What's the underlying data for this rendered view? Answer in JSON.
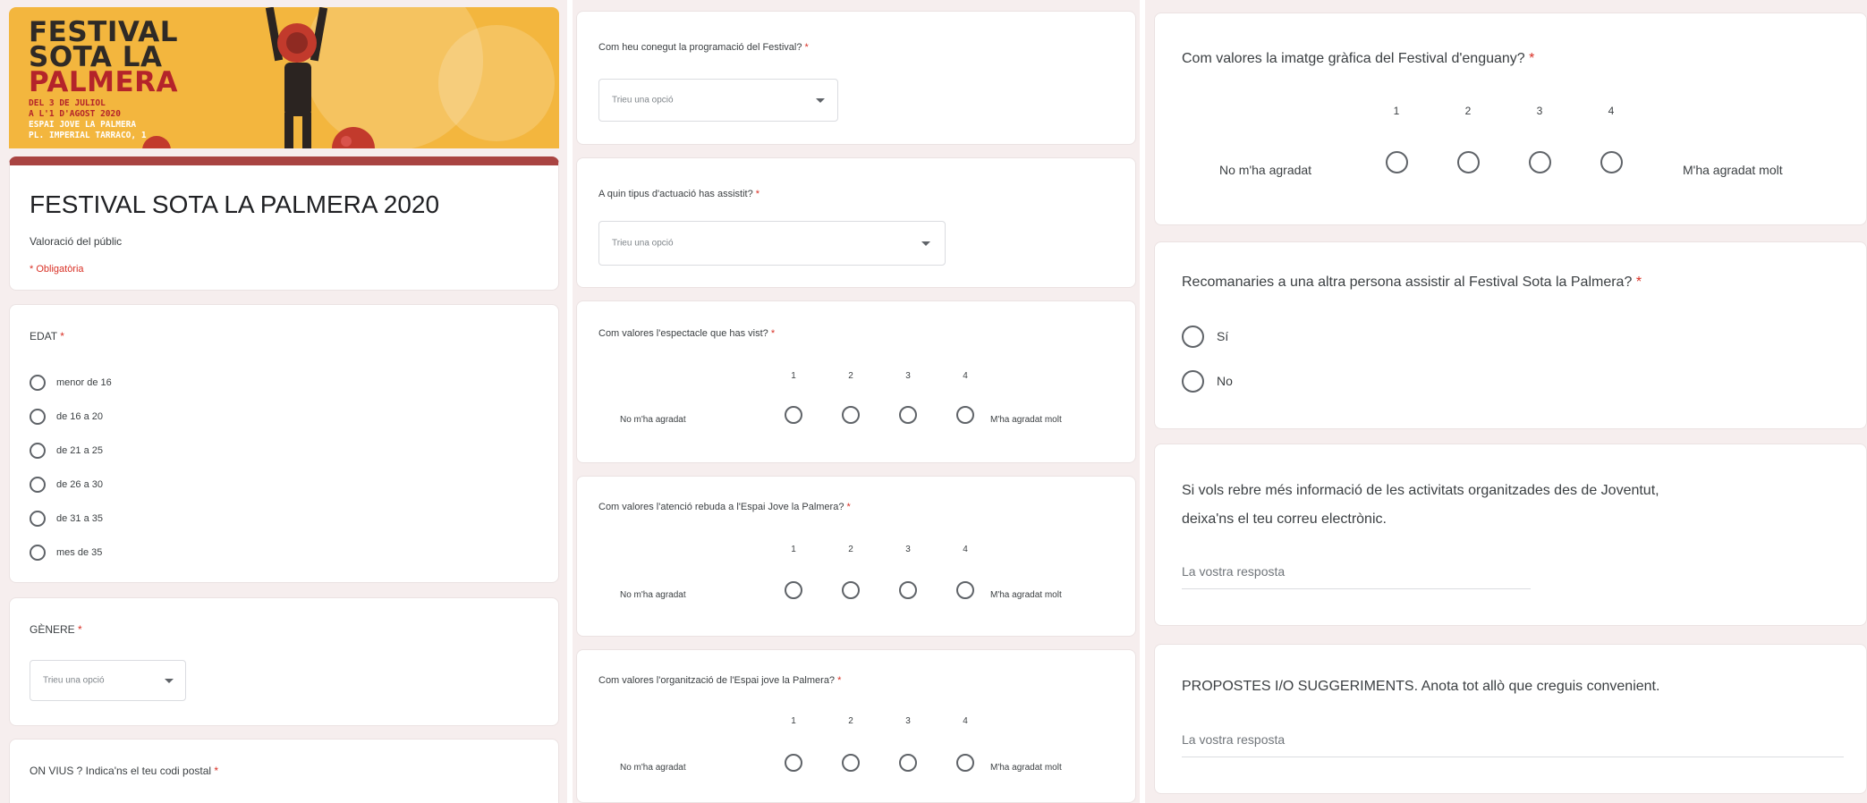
{
  "banner": {
    "title_lines": [
      "FESTIVAL",
      "SOTA LA",
      "PALMERA"
    ],
    "dates": "DEL 3 DE JULIOL",
    "dates2": "A L'1 D'AGOST 2020",
    "venue": "ESPAI JOVE LA PALMERA",
    "address": "PL. IMPERIAL TARRACO, 1"
  },
  "form": {
    "title": "FESTIVAL SOTA LA PALMERA 2020",
    "description": "Valoració del públic",
    "required_note": "* Obligatòria"
  },
  "age": {
    "question": "EDAT",
    "options": [
      "menor de 16",
      "de 16 a 20",
      "de 21 a 25",
      "de 26 a 30",
      "de 31 a 35",
      "mes de 35"
    ]
  },
  "gender": {
    "question": "GÈNERE",
    "placeholder": "Trieu una opció"
  },
  "postal": {
    "question": "ON VIUS ? Indica'ns el teu codi postal"
  },
  "how_known": {
    "question": "Com heu conegut la programació del Festival?",
    "placeholder": "Trieu una opció"
  },
  "performance_type": {
    "question": "A quin tipus d'actuació has assistit?",
    "placeholder": "Trieu una opció"
  },
  "scales_mid": [
    {
      "question": "Com valores l'espectacle que has vist?",
      "low": "No m'ha agradat",
      "high": "M'ha agradat molt",
      "numbers": [
        "1",
        "2",
        "3",
        "4"
      ]
    },
    {
      "question": "Com valores l'atenció rebuda a l'Espai Jove la Palmera?",
      "low": "No m'ha agradat",
      "high": "M'ha agradat molt",
      "numbers": [
        "1",
        "2",
        "3",
        "4"
      ]
    },
    {
      "question": "Com valores l'organització de l'Espai jove la Palmera?",
      "low": "No m'ha agradat",
      "high": "M'ha agradat molt",
      "numbers": [
        "1",
        "2",
        "3",
        "4"
      ]
    }
  ],
  "image_rating": {
    "question": "Com valores la imatge gràfica del Festival d'enguany?",
    "low": "No m'ha agradat",
    "high": "M'ha agradat molt",
    "numbers": [
      "1",
      "2",
      "3",
      "4"
    ]
  },
  "recommend": {
    "question": "Recomanaries a una altra persona assistir al Festival Sota la Palmera?",
    "options": [
      "Sí",
      "No"
    ]
  },
  "email": {
    "question_line1": "Si vols rebre més informació de les activitats organitzades des de Joventut,",
    "question_line2": "deixa'ns el teu correu electrònic.",
    "placeholder": "La vostra resposta"
  },
  "proposals": {
    "question": "PROPOSTES I/O SUGGERIMENTS. Anota tot allò que creguis convenient.",
    "placeholder": "La vostra resposta"
  },
  "required_mark": "*",
  "colors": {
    "accent": "#a94442",
    "banner": "#f3b63e",
    "required": "#d93025"
  }
}
